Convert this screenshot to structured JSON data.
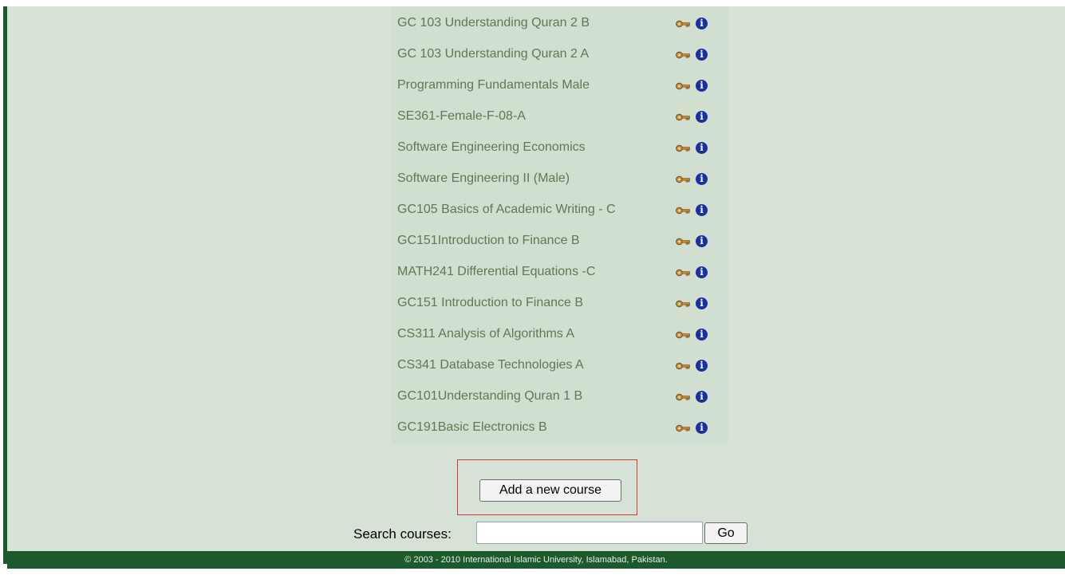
{
  "courses": [
    {
      "name": "GC 103 Understanding Quran 2 B"
    },
    {
      "name": "GC 103 Understanding Quran 2 A"
    },
    {
      "name": "Programming Fundamentals Male"
    },
    {
      "name": "SE361-Female-F-08-A"
    },
    {
      "name": "Software Engineering Economics"
    },
    {
      "name": "Software Engineering II (Male)"
    },
    {
      "name": "GC105 Basics of Academic Writing - C"
    },
    {
      "name": "GC151Introduction to Finance B"
    },
    {
      "name": "MATH241 Differential Equations -C"
    },
    {
      "name": "GC151 Introduction to Finance B"
    },
    {
      "name": "CS311 Analysis of Algorithms A"
    },
    {
      "name": "CS341 Database Technologies A"
    },
    {
      "name": "GC101Understanding Quran 1 B"
    },
    {
      "name": "GC191Basic Electronics B"
    }
  ],
  "row_icons": {
    "key": "key-icon",
    "info": "info-icon",
    "info_glyph": "i"
  },
  "actions": {
    "add_course_label": "Add a new course"
  },
  "search": {
    "label": "Search courses:",
    "value": "",
    "go_label": "Go"
  },
  "footer": {
    "text": "© 2003 - 2010 International Islamic University, Islamabad, Pakistan."
  },
  "colors": {
    "accent_green": "#1c5a2c",
    "content_bg": "#d5e2d5",
    "link_color": "#5c7a53",
    "info_blue": "#1a2fa0",
    "highlight_red": "#d43a3a"
  }
}
